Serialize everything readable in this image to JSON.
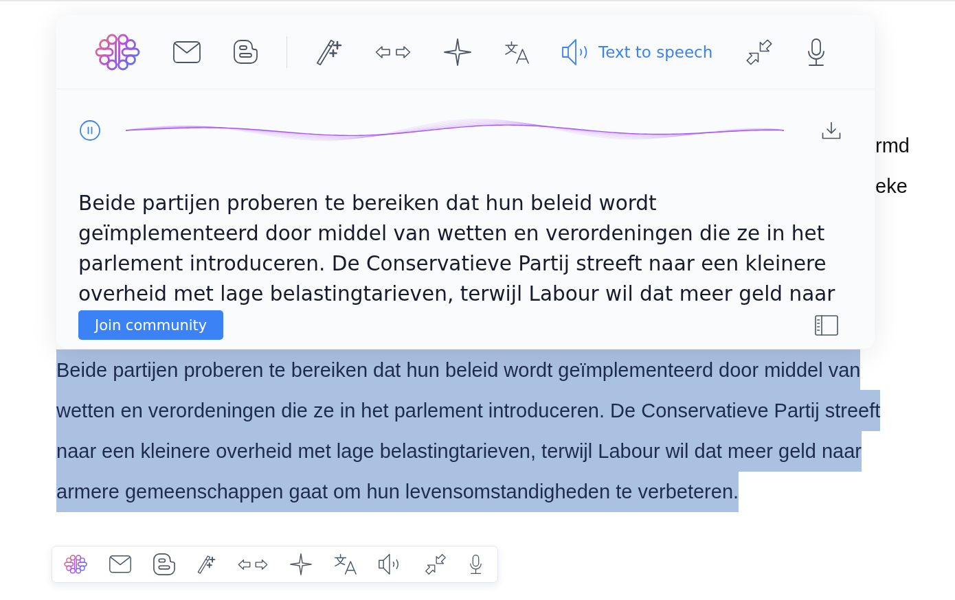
{
  "background_text": [
    "rmd",
    "eke"
  ],
  "popup": {
    "toolbar": {
      "groups": [
        [
          {
            "kind": "assistant",
            "selected": false
          },
          {
            "kind": "email",
            "selected": false
          },
          {
            "kind": "blog",
            "selected": false
          }
        ],
        [
          {
            "kind": "write",
            "selected": false
          },
          {
            "kind": "swap",
            "selected": false
          },
          {
            "kind": "improve",
            "selected": false
          },
          {
            "kind": "translate",
            "selected": false
          },
          {
            "kind": "speech",
            "label": "Text to speech",
            "selected": true
          },
          {
            "kind": "shorten",
            "selected": false
          },
          {
            "kind": "voice",
            "selected": false
          }
        ]
      ]
    },
    "player": {
      "playing": true
    },
    "text": "Beide partijen proberen te bereiken dat hun beleid wordt\ngeïmplementeerd door middel van wetten en verordeningen die ze in het parlement introduceren. De Conservatieve Partij streeft naar een kleinere overheid met lage belastingtarieven, terwijl Labour wil dat meer geld naar",
    "join_button": "Join community"
  },
  "selected_text": {
    "text": "Beide partijen proberen te bereiken dat hun beleid wordt geïmplementeerd door middel van wetten en verordeningen die ze in het parlement introduceren. De Conservatieve Partij streeft naar een kleinere overheid met lage belastingtarieven, terwijl Labour wil dat meer geld naar armere gemeenschappen gaat om hun levensomstandigheden te verbeteren.",
    "highlighted": true
  },
  "mini_toolbar": [
    {
      "kind": "assistant",
      "selected": false
    },
    {
      "kind": "email",
      "selected": false
    },
    {
      "kind": "blog",
      "selected": false
    },
    {
      "kind": "write",
      "selected": false
    },
    {
      "kind": "swap",
      "selected": false
    },
    {
      "kind": "improve",
      "selected": false
    },
    {
      "kind": "translate",
      "selected": false
    },
    {
      "kind": "speech",
      "selected": false
    },
    {
      "kind": "shorten",
      "selected": false
    },
    {
      "kind": "voice",
      "selected": false
    }
  ]
}
